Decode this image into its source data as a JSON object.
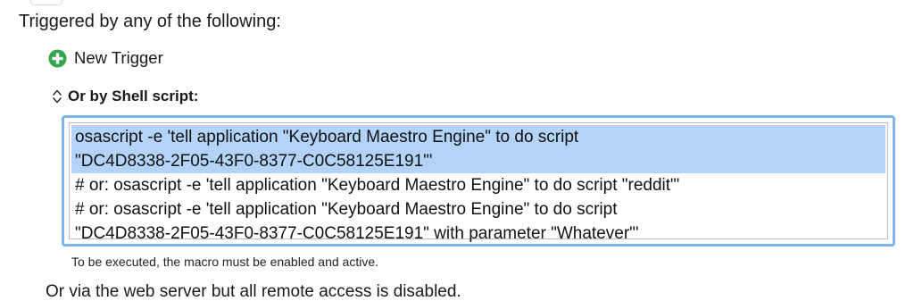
{
  "triggers": {
    "heading": "Triggered by any of the following:",
    "new_trigger_label": "New Trigger",
    "new_trigger_icon": "plus-circle-icon",
    "accent_green": "#33a64d"
  },
  "shell_script": {
    "header_label": "Or by Shell script:",
    "header_icon": "up-down-chevron-icon",
    "focus_ring_color": "#80b3ec",
    "selection_color": "#b3d3f9",
    "lines": [
      "osascript -e 'tell application \"Keyboard Maestro Engine\" to do script",
      "\"DC4D8338-2F05-43F0-8377-C0C58125E191\"'",
      "# or: osascript -e 'tell application \"Keyboard Maestro Engine\" to do script \"reddit\"'",
      "# or: osascript -e 'tell application \"Keyboard Maestro Engine\" to do script",
      "\"DC4D8338-2F05-43F0-8377-C0C58125E191\" with parameter \"Whatever\"'"
    ],
    "note": "To be executed, the macro must be enabled and active."
  },
  "web_server": {
    "text": "Or via the web server but all remote access is disabled."
  }
}
